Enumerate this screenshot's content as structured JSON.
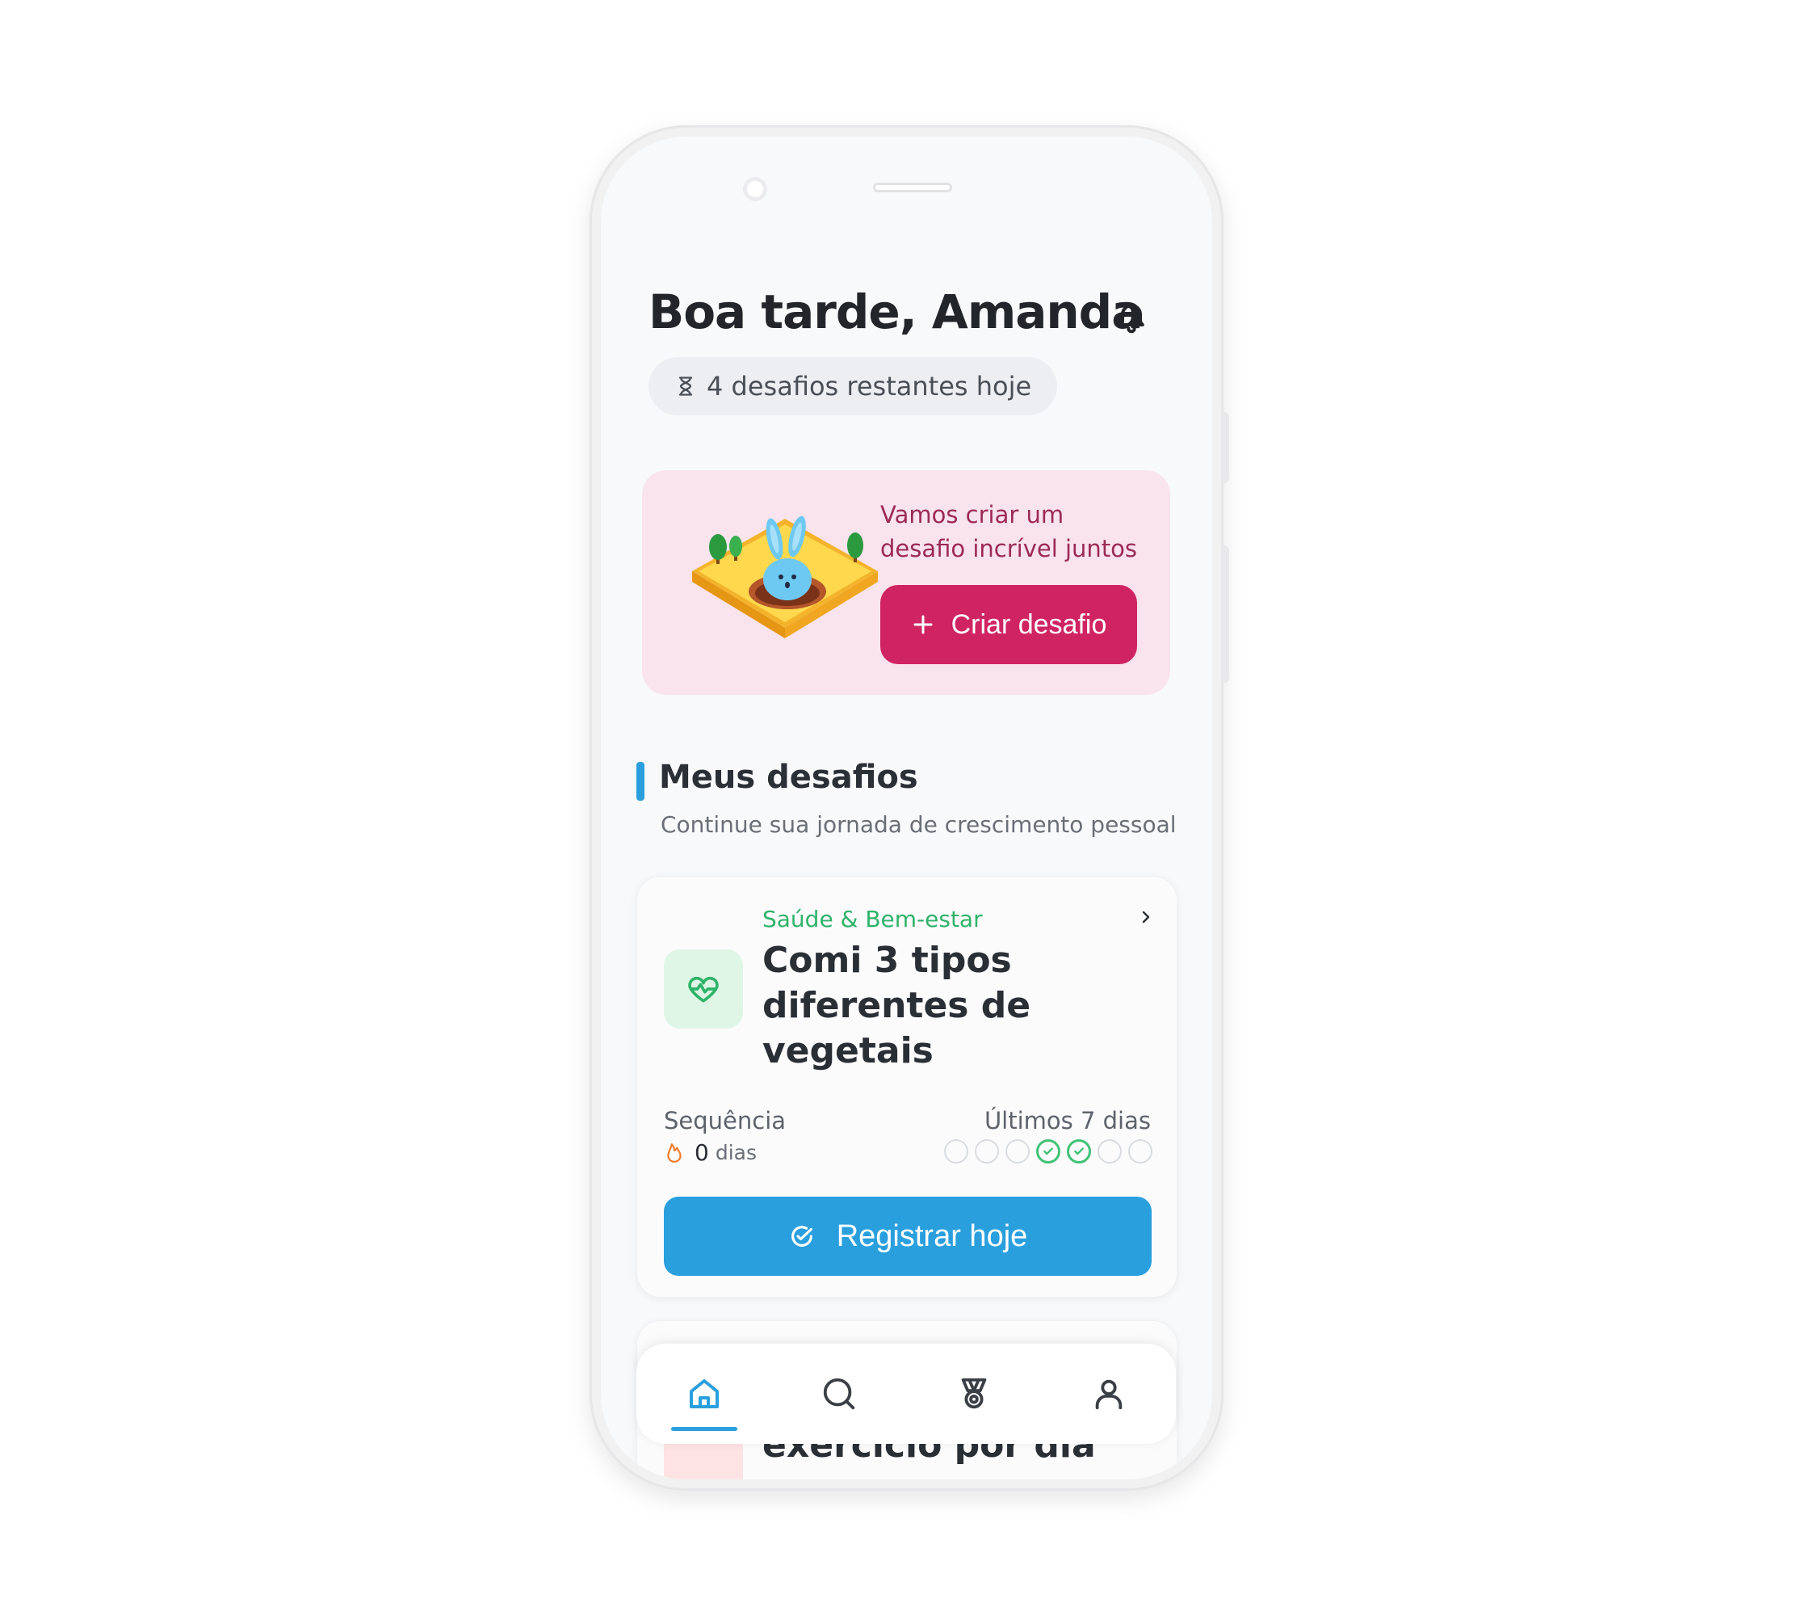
{
  "header": {
    "greeting": "Boa tarde, Amanda",
    "remaining": "4 desafios restantes hoje"
  },
  "promo": {
    "message": "Vamos criar um desafio incrível juntos",
    "button_label": "Criar desafio"
  },
  "section": {
    "title": "Meus desafios",
    "subtitle": "Continue sua jornada de crescimento pessoal"
  },
  "challenge": {
    "category": "Saúde & Bem-estar",
    "title": "Comi 3 tipos diferentes de vegetais",
    "streak_label": "Sequência",
    "streak_value": "0",
    "streak_unit": "dias",
    "last_days_label": "Últimos 7 dias",
    "last_days": [
      false,
      false,
      false,
      true,
      true,
      false,
      false
    ],
    "button_label": "Registrar hoje"
  },
  "next_challenge": {
    "title_partial": "exercício por dia"
  },
  "tabbar": {
    "items": [
      "home-icon",
      "search-icon",
      "medal-icon",
      "user-icon"
    ],
    "active": 0
  },
  "colors": {
    "primary": "#2a9fde",
    "accent": "#cf2461",
    "success": "#3fc275",
    "promo_bg": "#f9e3ec"
  }
}
